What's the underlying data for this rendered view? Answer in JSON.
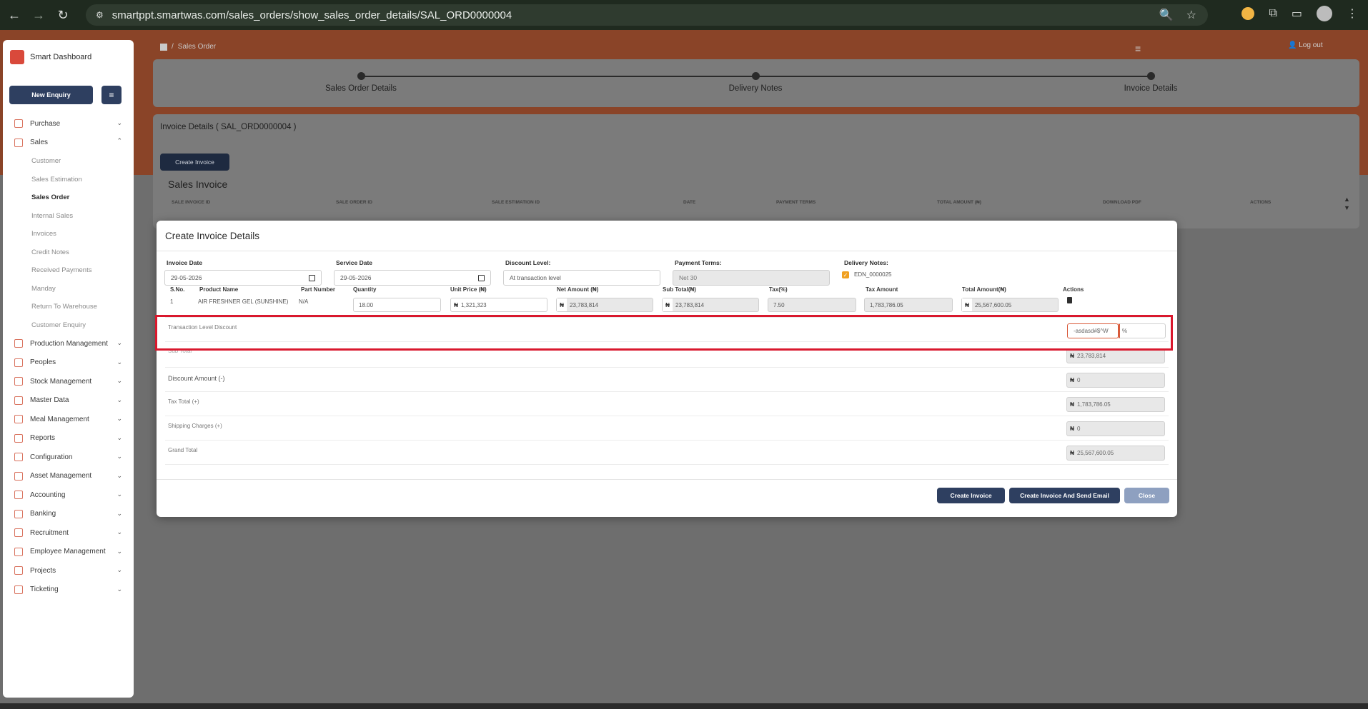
{
  "browser": {
    "url": "smartppt.smartwas.com/sales_orders/show_sales_order_details/SAL_ORD0000004"
  },
  "sidebar": {
    "brand": "Smart Dashboard",
    "new_enquiry": "New Enquiry",
    "items": [
      {
        "label": "Purchase"
      },
      {
        "label": "Sales"
      }
    ],
    "sales_sub": [
      {
        "label": "Customer"
      },
      {
        "label": "Sales Estimation"
      },
      {
        "label": "Sales Order"
      },
      {
        "label": "Internal Sales"
      },
      {
        "label": "Invoices"
      },
      {
        "label": "Credit Notes"
      },
      {
        "label": "Received Payments"
      },
      {
        "label": "Manday"
      },
      {
        "label": "Return To Warehouse"
      },
      {
        "label": "Customer Enquiry"
      }
    ],
    "more_items": [
      {
        "label": "Production Management"
      },
      {
        "label": "Peoples"
      },
      {
        "label": "Stock Management"
      },
      {
        "label": "Master Data"
      },
      {
        "label": "Meal Management"
      },
      {
        "label": "Reports"
      },
      {
        "label": "Configuration"
      },
      {
        "label": "Asset Management"
      },
      {
        "label": "Accounting"
      },
      {
        "label": "Banking"
      },
      {
        "label": "Recruitment"
      },
      {
        "label": "Employee Management"
      },
      {
        "label": "Projects"
      },
      {
        "label": "Ticketing"
      }
    ]
  },
  "header": {
    "breadcrumb_sep": "/",
    "breadcrumb_current": "Sales Order",
    "logout": "Log out"
  },
  "steps": [
    "Sales Order Details",
    "Delivery Notes",
    "Invoice Details"
  ],
  "details": {
    "title": "Invoice Details ( SAL_ORD0000004 )",
    "create_invoice": "Create Invoice",
    "sales_invoice_title": "Sales Invoice",
    "columns": [
      "SALE INVOICE ID",
      "SALE ORDER ID",
      "SALE ESTIMATION ID",
      "DATE",
      "PAYMENT TERMS",
      "TOTAL AMOUNT (₦)",
      "DOWNLOAD PDF",
      "ACTIONS"
    ]
  },
  "modal": {
    "title": "Create Invoice Details",
    "invoice_date_label": "Invoice Date",
    "invoice_date": "29-05-2026",
    "service_date_label": "Service Date",
    "service_date": "29-05-2026",
    "discount_level_label": "Discount Level:",
    "discount_level": "At transaction level",
    "payment_terms_label": "Payment Terms:",
    "payment_terms": "Net 30",
    "delivery_notes_label": "Delivery Notes:",
    "delivery_note": "EDN_0000025",
    "line_columns": {
      "sno": "S.No.",
      "product": "Product Name",
      "part": "Part Number",
      "qty": "Quantity",
      "unit_price": "Unit Price (₦)",
      "net_amount": "Net Amount (₦)",
      "sub_total": "Sub Total(₦)",
      "tax": "Tax(%)",
      "tax_amount": "Tax Amount",
      "total_amount": "Total Amount(₦)",
      "actions": "Actions"
    },
    "line": {
      "sno": "1",
      "product": "AIR FRESHNER GEL (SUNSHINE)",
      "part": "N/A",
      "qty": "18.00",
      "unit_price": "1,321,323",
      "net_amount": "23,783,814",
      "sub_total": "23,783,814",
      "tax": "7.50",
      "tax_amount": "1,783,786.05",
      "total_amount": "25,567,600.05"
    },
    "currency": "₦",
    "transaction_discount_label": "Transaction Level Discount",
    "transaction_discount_value": "-asdasd#$^W",
    "percent": "%",
    "sub_total_label": "Sub Total",
    "sub_total": "23,783,814",
    "discount_amount_label": "Discount Amount (-)",
    "discount_amount": "0",
    "tax_total_label": "Tax Total (+)",
    "tax_total": "1,783,786.05",
    "shipping_label": "Shipping Charges (+)",
    "shipping": "0",
    "grand_total_label": "Grand Total",
    "grand_total": "25,567,600.05",
    "btn_create": "Create Invoice",
    "btn_create_email": "Create Invoice And Send Email",
    "btn_close": "Close"
  }
}
